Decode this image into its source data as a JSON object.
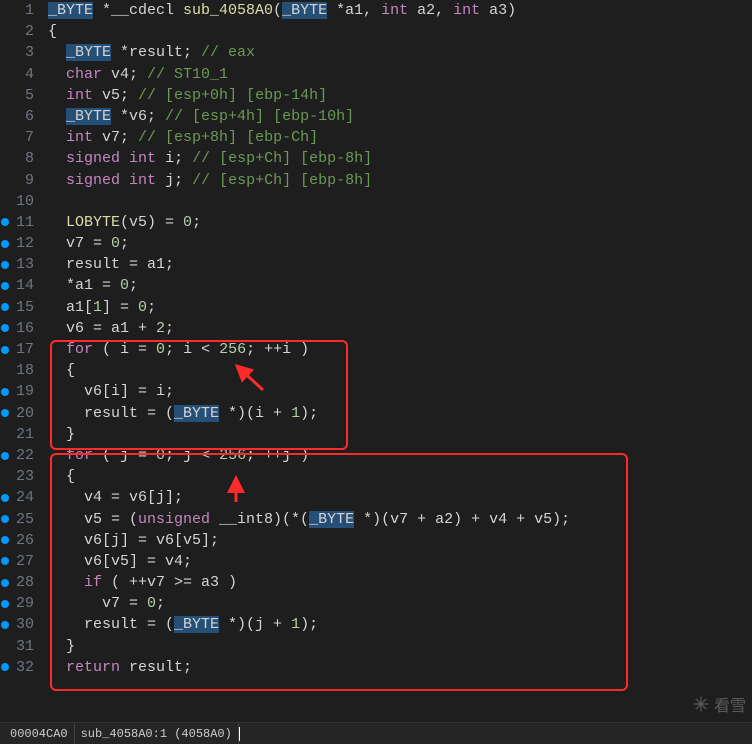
{
  "lines": [
    {
      "n": 1,
      "bp": false,
      "tokens": [
        [
          "hl",
          "_BYTE"
        ],
        [
          "p",
          " *__cdecl "
        ],
        [
          "fn",
          "sub_4058A0"
        ],
        [
          "p",
          "("
        ],
        [
          "hl",
          "_BYTE"
        ],
        [
          "p",
          " *a1, "
        ],
        [
          "k",
          "int"
        ],
        [
          "p",
          " a2, "
        ],
        [
          "k",
          "int"
        ],
        [
          "p",
          " a3)"
        ]
      ]
    },
    {
      "n": 2,
      "bp": false,
      "tokens": [
        [
          "p",
          "{"
        ]
      ]
    },
    {
      "n": 3,
      "bp": false,
      "tokens": [
        [
          "p",
          "  "
        ],
        [
          "hl",
          "_BYTE"
        ],
        [
          "p",
          " *result; "
        ],
        [
          "c",
          "// eax"
        ]
      ]
    },
    {
      "n": 4,
      "bp": false,
      "tokens": [
        [
          "p",
          "  "
        ],
        [
          "k",
          "char"
        ],
        [
          "p",
          " v4; "
        ],
        [
          "c",
          "// ST10_1"
        ]
      ]
    },
    {
      "n": 5,
      "bp": false,
      "tokens": [
        [
          "p",
          "  "
        ],
        [
          "k",
          "int"
        ],
        [
          "p",
          " v5; "
        ],
        [
          "c",
          "// [esp+0h] [ebp-14h]"
        ]
      ]
    },
    {
      "n": 6,
      "bp": false,
      "tokens": [
        [
          "p",
          "  "
        ],
        [
          "hl",
          "_BYTE"
        ],
        [
          "p",
          " *v6; "
        ],
        [
          "c",
          "// [esp+4h] [ebp-10h]"
        ]
      ]
    },
    {
      "n": 7,
      "bp": false,
      "tokens": [
        [
          "p",
          "  "
        ],
        [
          "k",
          "int"
        ],
        [
          "p",
          " v7; "
        ],
        [
          "c",
          "// [esp+8h] [ebp-Ch]"
        ]
      ]
    },
    {
      "n": 8,
      "bp": false,
      "tokens": [
        [
          "p",
          "  "
        ],
        [
          "k",
          "signed"
        ],
        [
          "p",
          " "
        ],
        [
          "k",
          "int"
        ],
        [
          "p",
          " i; "
        ],
        [
          "c",
          "// [esp+Ch] [ebp-8h]"
        ]
      ]
    },
    {
      "n": 9,
      "bp": false,
      "tokens": [
        [
          "p",
          "  "
        ],
        [
          "k",
          "signed"
        ],
        [
          "p",
          " "
        ],
        [
          "k",
          "int"
        ],
        [
          "p",
          " j; "
        ],
        [
          "c",
          "// [esp+Ch] [ebp-8h]"
        ]
      ]
    },
    {
      "n": 10,
      "bp": false,
      "tokens": [
        [
          "p",
          ""
        ]
      ]
    },
    {
      "n": 11,
      "bp": true,
      "tokens": [
        [
          "p",
          "  "
        ],
        [
          "fn",
          "LOBYTE"
        ],
        [
          "p",
          "(v5) = "
        ],
        [
          "n",
          "0"
        ],
        [
          "p",
          ";"
        ]
      ]
    },
    {
      "n": 12,
      "bp": true,
      "tokens": [
        [
          "p",
          "  v7 = "
        ],
        [
          "n",
          "0"
        ],
        [
          "p",
          ";"
        ]
      ]
    },
    {
      "n": 13,
      "bp": true,
      "tokens": [
        [
          "p",
          "  result = a1;"
        ]
      ]
    },
    {
      "n": 14,
      "bp": true,
      "tokens": [
        [
          "p",
          "  *a1 = "
        ],
        [
          "n",
          "0"
        ],
        [
          "p",
          ";"
        ]
      ]
    },
    {
      "n": 15,
      "bp": true,
      "tokens": [
        [
          "p",
          "  a1["
        ],
        [
          "n",
          "1"
        ],
        [
          "p",
          "] = "
        ],
        [
          "n",
          "0"
        ],
        [
          "p",
          ";"
        ]
      ]
    },
    {
      "n": 16,
      "bp": true,
      "tokens": [
        [
          "p",
          "  v6 = a1 + "
        ],
        [
          "n",
          "2"
        ],
        [
          "p",
          ";"
        ]
      ]
    },
    {
      "n": 17,
      "bp": true,
      "tokens": [
        [
          "p",
          "  "
        ],
        [
          "k",
          "for"
        ],
        [
          "p",
          " ( i = "
        ],
        [
          "n",
          "0"
        ],
        [
          "p",
          "; i < "
        ],
        [
          "n",
          "256"
        ],
        [
          "p",
          "; ++i )"
        ]
      ]
    },
    {
      "n": 18,
      "bp": false,
      "tokens": [
        [
          "p",
          "  {"
        ]
      ]
    },
    {
      "n": 19,
      "bp": true,
      "tokens": [
        [
          "p",
          "    v6[i] = i;"
        ]
      ]
    },
    {
      "n": 20,
      "bp": true,
      "tokens": [
        [
          "p",
          "    result = ("
        ],
        [
          "hl",
          "_BYTE"
        ],
        [
          "p",
          " *)(i + "
        ],
        [
          "n",
          "1"
        ],
        [
          "p",
          ");"
        ]
      ]
    },
    {
      "n": 21,
      "bp": false,
      "tokens": [
        [
          "p",
          "  }"
        ]
      ]
    },
    {
      "n": 22,
      "bp": true,
      "tokens": [
        [
          "p",
          "  "
        ],
        [
          "k",
          "for"
        ],
        [
          "p",
          " ( j = "
        ],
        [
          "n",
          "0"
        ],
        [
          "p",
          "; j < "
        ],
        [
          "n",
          "256"
        ],
        [
          "p",
          "; ++j )"
        ]
      ]
    },
    {
      "n": 23,
      "bp": false,
      "tokens": [
        [
          "p",
          "  {"
        ]
      ]
    },
    {
      "n": 24,
      "bp": true,
      "tokens": [
        [
          "p",
          "    v4 = v6[j];"
        ]
      ]
    },
    {
      "n": 25,
      "bp": true,
      "tokens": [
        [
          "p",
          "    v5 = ("
        ],
        [
          "k",
          "unsigned"
        ],
        [
          "p",
          " __int8)(*("
        ],
        [
          "hl",
          "_BYTE"
        ],
        [
          "p",
          " *)(v7 + a2) + v4 + v5);"
        ]
      ]
    },
    {
      "n": 26,
      "bp": true,
      "tokens": [
        [
          "p",
          "    v6[j] = v6[v5];"
        ]
      ]
    },
    {
      "n": 27,
      "bp": true,
      "tokens": [
        [
          "p",
          "    v6[v5] = v4;"
        ]
      ]
    },
    {
      "n": 28,
      "bp": true,
      "tokens": [
        [
          "p",
          "    "
        ],
        [
          "k",
          "if"
        ],
        [
          "p",
          " ( ++v7 >= a3 )"
        ]
      ]
    },
    {
      "n": 29,
      "bp": true,
      "tokens": [
        [
          "p",
          "      v7 = "
        ],
        [
          "n",
          "0"
        ],
        [
          "p",
          ";"
        ]
      ]
    },
    {
      "n": 30,
      "bp": true,
      "tokens": [
        [
          "p",
          "    result = ("
        ],
        [
          "hl",
          "_BYTE"
        ],
        [
          "p",
          " *)(j + "
        ],
        [
          "n",
          "1"
        ],
        [
          "p",
          ");"
        ]
      ]
    },
    {
      "n": 31,
      "bp": false,
      "tokens": [
        [
          "p",
          "  }"
        ]
      ]
    },
    {
      "n": 32,
      "bp": true,
      "tokens": [
        [
          "p",
          "  "
        ],
        [
          "k",
          "return"
        ],
        [
          "p",
          " result;"
        ]
      ]
    }
  ],
  "status": {
    "addr": "00004CA0",
    "loc": "sub_4058A0:1 (4058A0)"
  },
  "watermark": "看雪"
}
